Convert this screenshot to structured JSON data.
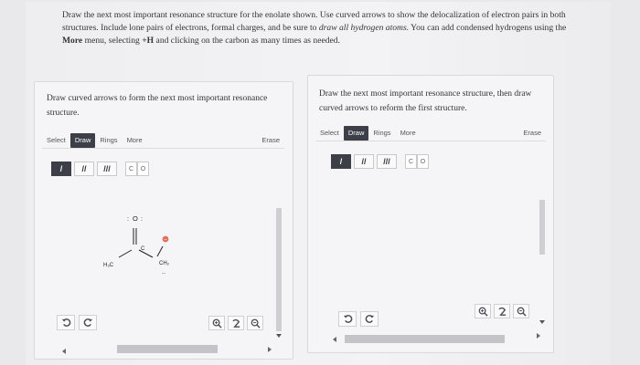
{
  "instructions": {
    "part1": "Draw the next most important resonance structure for the enolate shown. Use curved arrows to show the delocalization of electron pairs in both structures. Include lone pairs of electrons, formal charges, and be sure to ",
    "italic": "draw all hydrogen atoms.",
    "part2": " You can add condensed hydrogens using the ",
    "bold_more": "More",
    "part3": " menu, selecting ",
    "bold_h": "+H",
    "part4": " and clicking on the carbon as many times as needed."
  },
  "left_panel": {
    "title": "Draw curved arrows to form the next most important resonance structure.",
    "toolbar": {
      "select": "Select",
      "draw": "Draw",
      "rings": "Rings",
      "more": "More",
      "erase": "Erase"
    },
    "bonds": {
      "single": "/",
      "double": "//",
      "triple": "///"
    },
    "atoms": {
      "carbon": "C",
      "oxygen": "O"
    },
    "molecule": {
      "oxygen": "O",
      "carbon": "C",
      "methyl_left": "H₃C",
      "methylene_right": "CH₂",
      "lone_pair_oxygen_left": ":",
      "lone_pair_oxygen_right": ":",
      "lone_pair_carbon": "..",
      "charge": "−"
    }
  },
  "right_panel": {
    "title": "Draw the next most important resonance structure, then draw curved arrows to reform the first structure.",
    "toolbar": {
      "select": "Select",
      "draw": "Draw",
      "rings": "Rings",
      "more": "More",
      "erase": "Erase"
    },
    "bonds": {
      "single": "/",
      "double": "//",
      "triple": "///"
    },
    "atoms": {
      "carbon": "C",
      "oxygen": "O"
    }
  },
  "colors": {
    "active": "#3d3f48",
    "charge": "#e0715a",
    "icon": "#4a4c57"
  }
}
